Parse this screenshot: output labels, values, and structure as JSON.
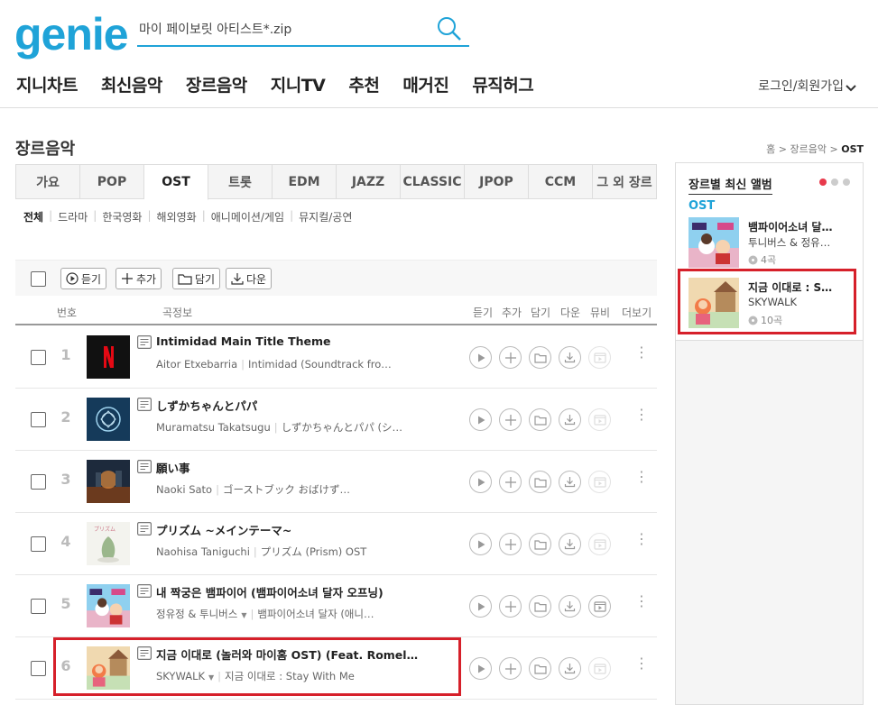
{
  "header": {
    "logo": "genie",
    "search_value": "마이 페이보릿 아티스트*.zip",
    "login": "로그인/회원가입"
  },
  "gnb": [
    "지니차트",
    "최신음악",
    "장르음악",
    "지니TV",
    "추천",
    "매거진",
    "뮤직허그"
  ],
  "page": {
    "title": "장르음악",
    "breadcrumb": {
      "home": "홈",
      "sep": ">",
      "level1": "장르음악",
      "current": "OST"
    }
  },
  "genre_tabs": [
    "가요",
    "POP",
    "OST",
    "트롯",
    "EDM",
    "JAZZ",
    "CLASSIC",
    "JPOP",
    "CCM",
    "그 외 장르"
  ],
  "active_tab": "OST",
  "sub_tabs": [
    "전체",
    "드라마",
    "한국영화",
    "해외영화",
    "애니메이션/게임",
    "뮤지컬/공연"
  ],
  "toolbar": {
    "listen": "듣기",
    "add": "추가",
    "save": "담기",
    "download": "다운"
  },
  "table_header": {
    "num": "번호",
    "info": "곡정보",
    "listen": "듣기",
    "add": "추가",
    "save": "담기",
    "down": "다운",
    "mv": "뮤비",
    "more": "더보기"
  },
  "songs": [
    {
      "rank": "1",
      "title": "Intimidad Main Title Theme",
      "artist": "Aitor Etxebarria",
      "album": "Intimidad (Soundtrack fro…",
      "has_dropdown": false,
      "mv": false,
      "cover": "netflix"
    },
    {
      "rank": "2",
      "title": "しずかちゃんとパパ",
      "artist": "Muramatsu Takatsugu",
      "album": "しずかちゃんとパパ (シ…",
      "has_dropdown": false,
      "mv": false,
      "cover": "blue"
    },
    {
      "rank": "3",
      "title": "願い事",
      "artist": "Naoki Sato",
      "album": "ゴーストブック おばけず…",
      "has_dropdown": false,
      "mv": false,
      "cover": "ghost"
    },
    {
      "rank": "4",
      "title": "プリズム ~メインテーマ~",
      "artist": "Naohisa Taniguchi",
      "album": "プリズム (Prism) OST",
      "has_dropdown": false,
      "mv": false,
      "cover": "prism"
    },
    {
      "rank": "5",
      "title": "내 짝궁은 뱀파이어 (뱀파이어소녀 달자 오프닝)",
      "artist": "정유정 & 투니버스",
      "album": "뱀파이어소녀 달자 (애니…",
      "has_dropdown": true,
      "mv": true,
      "cover": "vamp"
    },
    {
      "rank": "6",
      "title": "지금 이대로 (놀러와 마이홈 OST) (Feat. Romel…",
      "artist": "SKYWALK",
      "album": "지금 이대로 : Stay With Me",
      "has_dropdown": true,
      "mv": false,
      "cover": "home"
    }
  ],
  "sidebar": {
    "heading": "장르별 최신 앨범",
    "genre": "OST",
    "albums": [
      {
        "title": "뱀파이어소녀 달…",
        "artist": "투니버스 & 정유…",
        "count": "4곡",
        "cover": "vamp"
      },
      {
        "title": "지금 이대로 : S…",
        "artist": "SKYWALK",
        "count": "10곡",
        "cover": "home"
      }
    ]
  },
  "colors": {
    "brand": "#1fa3d8",
    "highlight": "#d6202a",
    "dot_active": "#e83a4c"
  }
}
